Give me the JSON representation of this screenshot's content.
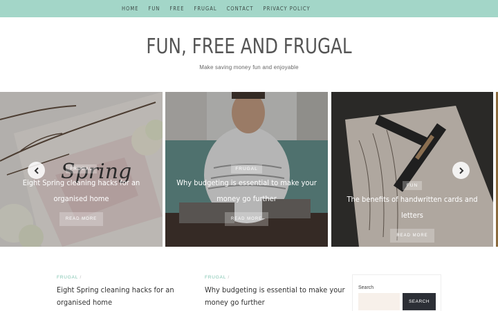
{
  "nav": {
    "items": [
      "HOME",
      "FUN",
      "FREE",
      "FRUGAL",
      "CONTACT",
      "PRIVACY POLICY"
    ]
  },
  "header": {
    "title": "FUN, FREE AND FRUGAL",
    "tagline": "Make saving money fun and enjoyable"
  },
  "slider": {
    "slides": [
      {
        "category": "FRUGAL",
        "title": "Eight Spring cleaning hacks for an organised home",
        "read_more": "READ MORE"
      },
      {
        "category": "FRUGAL",
        "title": "Why budgeting is essential to make your money go further",
        "read_more": "READ MORE"
      },
      {
        "category": "FUN",
        "title": "The benefits of handwritten cards and letters",
        "read_more": "READ MORE"
      }
    ]
  },
  "posts": [
    {
      "category": "FRUGAL",
      "separator": "/",
      "title": "Eight Spring cleaning hacks for an organised home"
    },
    {
      "category": "FRUGAL",
      "separator": "/",
      "title": "Why budgeting is essential to make your money go further"
    }
  ],
  "sidebar": {
    "search_label": "Search",
    "search_button": "SEARCH",
    "search_value": ""
  },
  "colors": {
    "nav_bg": "#a3d6c8",
    "category_accent": "#7ec3af",
    "search_button_bg": "#2c2f36"
  }
}
